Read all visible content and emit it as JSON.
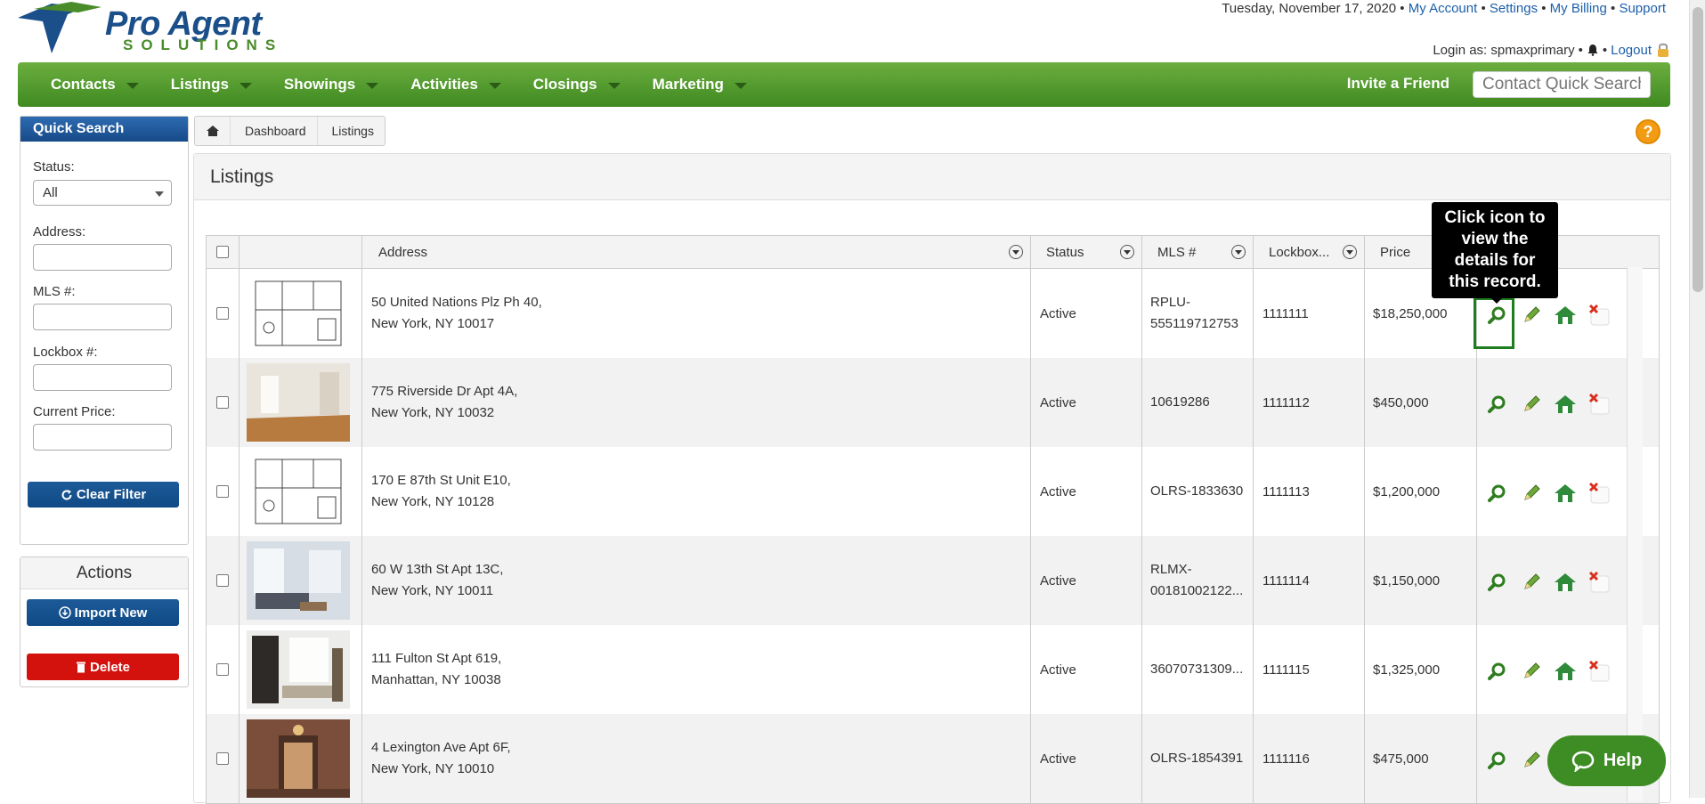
{
  "header": {
    "logo_title": "Pro Agent",
    "logo_subtitle": "SOLUTIONS",
    "date": "Tuesday, November 17, 2020",
    "links": [
      "My Account",
      "Settings",
      "My Billing",
      "Support"
    ],
    "login_prefix": "Login as: spmaxprimary",
    "logout": "Logout"
  },
  "nav": {
    "items": [
      "Contacts",
      "Listings",
      "Showings",
      "Activities",
      "Closings",
      "Marketing"
    ],
    "invite": "Invite a Friend",
    "quick_search_placeholder": "Contact Quick Search"
  },
  "sidebar": {
    "quick_search_title": "Quick Search",
    "status_label": "Status:",
    "status_value": "All",
    "address_label": "Address:",
    "mls_label": "MLS #:",
    "lockbox_label": "Lockbox #:",
    "price_label": "Current Price:",
    "clear_filter": "Clear Filter",
    "actions_title": "Actions",
    "import_new": "Import New",
    "delete": "Delete"
  },
  "breadcrumb": {
    "items": [
      "Dashboard",
      "Listings"
    ]
  },
  "listings": {
    "title": "Listings",
    "columns": [
      "Address",
      "Status",
      "MLS #",
      "Lockbox...",
      "Price"
    ],
    "rows": [
      {
        "address1": "50 United Nations Plz Ph 40,",
        "address2": "New York, NY 10017",
        "status": "Active",
        "mls1": "RPLU-",
        "mls2": "555119712753",
        "lockbox": "1111111",
        "price": "$18,250,000",
        "thumb": "floorplan"
      },
      {
        "address1": "775 Riverside Dr Apt 4A,",
        "address2": "New York, NY 10032",
        "status": "Active",
        "mls1": "10619286",
        "mls2": "",
        "lockbox": "1111112",
        "price": "$450,000",
        "thumb": "room-wood"
      },
      {
        "address1": "170 E 87th St Unit E10,",
        "address2": "New York, NY 10128",
        "status": "Active",
        "mls1": "OLRS-1833630",
        "mls2": "",
        "lockbox": "1111113",
        "price": "$1,200,000",
        "thumb": "floorplan"
      },
      {
        "address1": "60 W 13th St Apt 13C,",
        "address2": "New York, NY 10011",
        "status": "Active",
        "mls1": "RLMX-",
        "mls2": "00181002122...",
        "lockbox": "1111114",
        "price": "$1,150,000",
        "thumb": "living-room"
      },
      {
        "address1": "111 Fulton St Apt 619,",
        "address2": "Manhattan, NY 10038",
        "status": "Active",
        "mls1": "36070731309...",
        "mls2": "",
        "lockbox": "1111115",
        "price": "$1,325,000",
        "thumb": "loft"
      },
      {
        "address1": "4 Lexington Ave Apt 6F,",
        "address2": "New York, NY 10010",
        "status": "Active",
        "mls1": "OLRS-1854391",
        "mls2": "",
        "lockbox": "1111116",
        "price": "$475,000",
        "thumb": "lobby"
      }
    ]
  },
  "tooltip": "Click icon to view the details for this record.",
  "help_button": "Help",
  "help_icon": "?"
}
